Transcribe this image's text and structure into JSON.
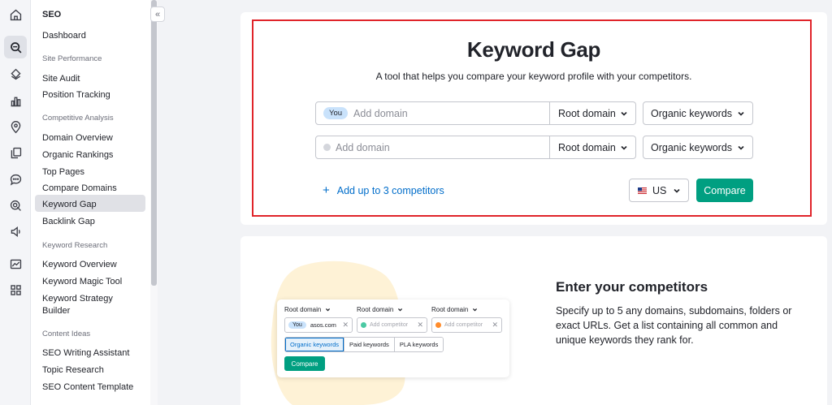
{
  "sidebar": {
    "heading": "SEO",
    "dashboard": "Dashboard",
    "sections": {
      "site_performance": "Site Performance",
      "competitive_analysis": "Competitive Analysis",
      "keyword_research": "Keyword Research",
      "content_ideas": "Content Ideas"
    },
    "items": {
      "site_audit": "Site Audit",
      "position_tracking": "Position Tracking",
      "domain_overview": "Domain Overview",
      "organic_rankings": "Organic Rankings",
      "top_pages": "Top Pages",
      "compare_domains": "Compare Domains",
      "keyword_gap": "Keyword Gap",
      "backlink_gap": "Backlink Gap",
      "keyword_overview": "Keyword Overview",
      "keyword_magic_tool": "Keyword Magic Tool",
      "keyword_strategy_builder_1": "Keyword Strategy",
      "keyword_strategy_builder_2": "Builder",
      "seo_writing_assistant": "SEO Writing Assistant",
      "topic_research": "Topic Research",
      "seo_content_template": "SEO Content Template"
    },
    "active_item": "keyword_gap",
    "collapse_glyph": "«"
  },
  "rail_icons": [
    "home-icon",
    "seo-toolkit-icon",
    "local-icon",
    "traffic-icon",
    "location-pin-icon",
    "content-icon",
    "social-icon",
    "ai-icon",
    "advertising-icon",
    "reports-icon",
    "apps-icon"
  ],
  "main": {
    "title": "Keyword Gap",
    "subtitle": "A tool that helps you compare your keyword profile with your competitors.",
    "you_chip": "You",
    "domain_placeholder": "Add domain",
    "root_domain": "Root domain",
    "organic_keywords": "Organic keywords",
    "add_competitors": "Add up to 3 competitors",
    "database": "US",
    "compare": "Compare"
  },
  "illustration": {
    "root_domain_1": "Root domain",
    "root_domain_2": "Root domain",
    "root_domain_3": "Root domain",
    "you_chip": "You",
    "your_domain": "asos.com",
    "competitor_placeholder_1": "Add competitor",
    "competitor_placeholder_2": "Add competitor",
    "tabs": [
      "Organic keywords",
      "Paid keywords",
      "PLA keywords"
    ],
    "active_tab": "Organic keywords",
    "compare": "Compare"
  },
  "onboarding": {
    "title": "Enter your competitors",
    "description": "Specify up to 5 any domains, subdomains, folders or exact URLs. Get a list containing all common and unique keywords they rank for."
  },
  "colors": {
    "accent_green": "#009f81",
    "link_blue": "#006dca",
    "highlight_red": "#e0242a",
    "competitor_green": "#4bc9a3",
    "competitor_orange": "#ff8c2b",
    "illustration_blob": "#fef2d6"
  }
}
